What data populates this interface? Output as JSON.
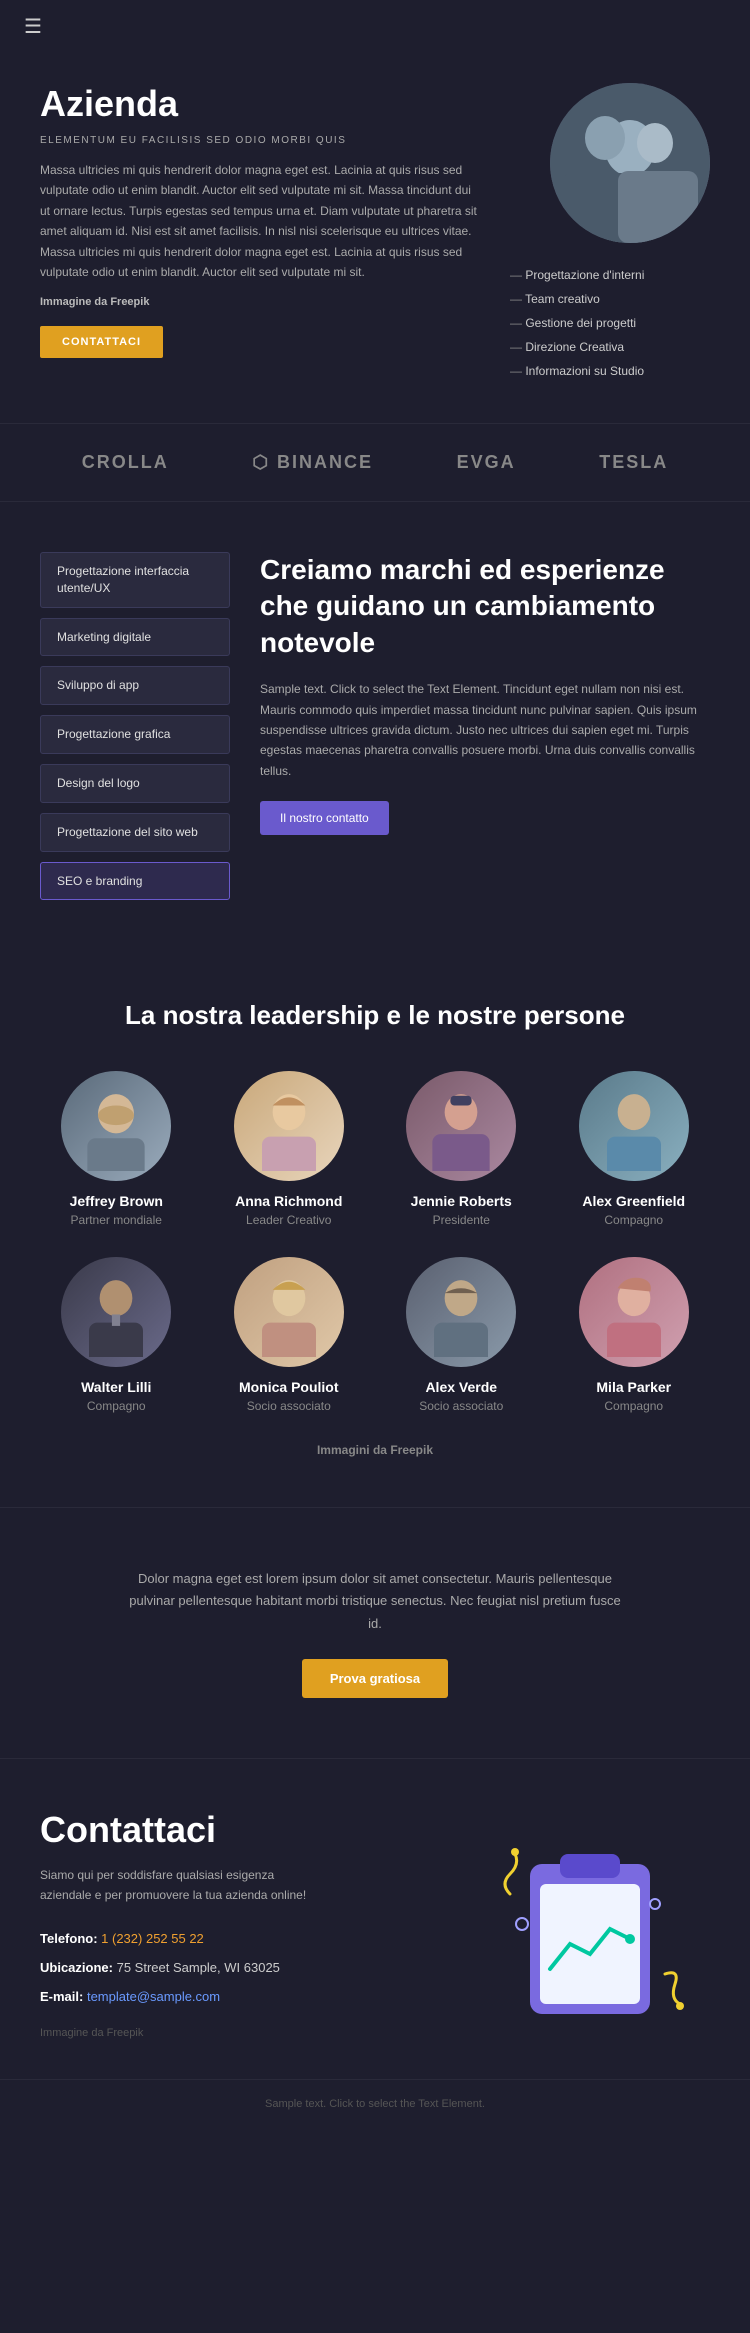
{
  "nav": {
    "hamburger_label": "☰"
  },
  "hero": {
    "title": "Azienda",
    "subtitle": "ELEMENTUM EU FACILISIS SED ODIO MORBI QUIS",
    "body": "Massa ultricies mi quis hendrerit dolor magna eget est. Lacinia at quis risus sed vulputate odio ut enim blandit. Auctor elit sed vulputate mi sit. Massa tincidunt dui ut ornare lectus. Turpis egestas sed tempus urna et. Diam vulputate ut pharetra sit amet aliquam id. Nisi est sit amet facilisis. In nisl nisi scelerisque eu ultrices vitae. Massa ultricies mi quis hendrerit dolor magna eget est. Lacinia at quis risus sed vulputate odio ut enim blandit. Auctor elit sed vulputate mi sit.",
    "credit_prefix": "Immagine da",
    "credit_source": "Freepik",
    "button_label": "CONTATTACI",
    "list_items": [
      "Progettazione d'interni",
      "Team creativo",
      "Gestione dei progetti",
      "Direzione Creativa",
      "Informazioni su Studio"
    ]
  },
  "brands": {
    "items": [
      {
        "name": "CROLLA",
        "id": "crolla"
      },
      {
        "name": "⬡ BINANCE",
        "id": "binance"
      },
      {
        "name": "EVGA",
        "id": "evga"
      },
      {
        "name": "TESLA",
        "id": "tesla"
      }
    ]
  },
  "services": {
    "buttons": [
      {
        "label": "Progettazione interfaccia utente/UX",
        "active": false
      },
      {
        "label": "Marketing digitale",
        "active": false
      },
      {
        "label": "Sviluppo di app",
        "active": false
      },
      {
        "label": "Progettazione grafica",
        "active": false
      },
      {
        "label": "Design del logo",
        "active": false
      },
      {
        "label": "Progettazione del sito web",
        "active": false
      },
      {
        "label": "SEO e branding",
        "active": true
      }
    ],
    "heading": "Creiamo marchi ed esperienze che guidano un cambiamento notevole",
    "body": "Sample text. Click to select the Text Element. Tincidunt eget nullam non nisi est. Mauris commodo quis imperdiet massa tincidunt nunc pulvinar sapien. Quis ipsum suspendisse ultrices gravida dictum. Justo nec ultrices dui sapien eget mi. Turpis egestas maecenas pharetra convallis posuere morbi. Urna duis convallis convallis tellus.",
    "button_label": "Il nostro contatto"
  },
  "leadership": {
    "title": "La nostra leadership e le nostre persone",
    "members": [
      {
        "name": "Jeffrey Brown",
        "role": "Partner mondiale",
        "avatar_class": "male1"
      },
      {
        "name": "Anna Richmond",
        "role": "Leader Creativo",
        "avatar_class": "female1"
      },
      {
        "name": "Jennie Roberts",
        "role": "Presidente",
        "avatar_class": "female2"
      },
      {
        "name": "Alex Greenfield",
        "role": "Compagno",
        "avatar_class": "male2"
      },
      {
        "name": "Walter Lilli",
        "role": "Compagno",
        "avatar_class": "male3"
      },
      {
        "name": "Monica Pouliot",
        "role": "Socio associato",
        "avatar_class": "female3"
      },
      {
        "name": "Alex Verde",
        "role": "Socio associato",
        "avatar_class": "male4"
      },
      {
        "name": "Mila Parker",
        "role": "Compagno",
        "avatar_class": "female4"
      }
    ],
    "credit_prefix": "Immagini da",
    "credit_source": "Freepik"
  },
  "cta": {
    "body": "Dolor magna eget est lorem ipsum dolor sit amet consectetur. Mauris pellentesque pulvinar pellentesque habitant morbi tristique senectus. Nec feugiat nisl pretium fusce id.",
    "button_label": "Prova gratiosa"
  },
  "contact": {
    "title": "Contattaci",
    "body": "Siamo qui per soddisfare qualsiasi esigenza aziendale e per promuovere la tua azienda online!",
    "phone_label": "Telefono:",
    "phone_value": "1 (232) 252 55 22",
    "address_label": "Ubicazione:",
    "address_value": "75 Street Sample, WI 63025",
    "email_label": "E-mail:",
    "email_value": "template@sample.com",
    "credit": "Immagine da Freepik"
  },
  "footer": {
    "text": "Sample text. Click to select the Text Element."
  }
}
